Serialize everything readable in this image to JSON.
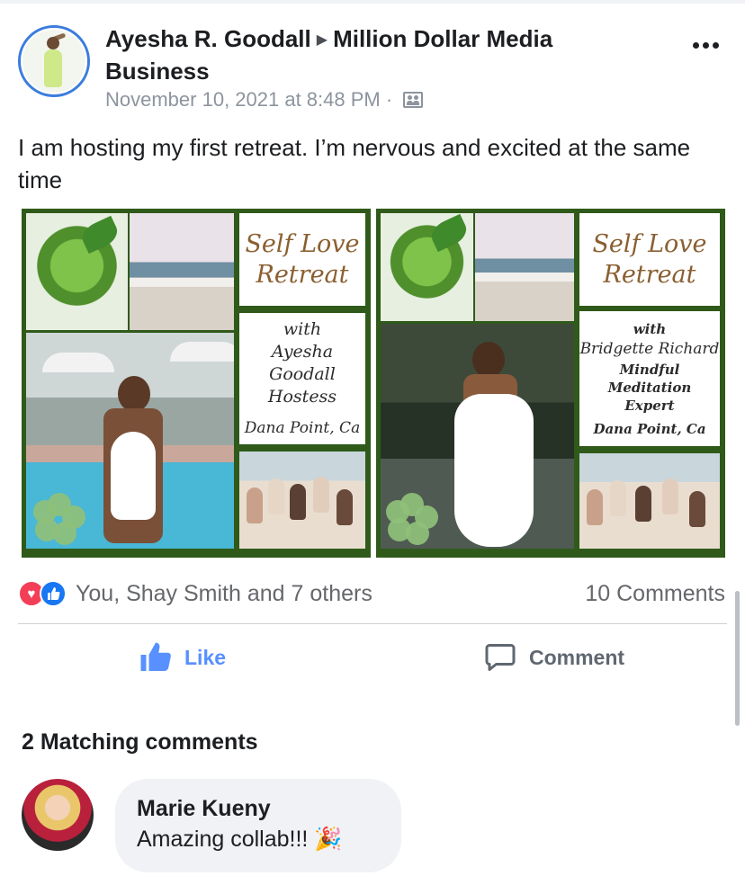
{
  "post": {
    "author_name": "Ayesha R. Goodall",
    "group_name": "Million Dollar Media Business",
    "timestamp": "November 10, 2021 at 8:48 PM",
    "separator": "·",
    "audience_icon": "friends-icon",
    "text": "I am hosting my first retreat. I’m nervous and excited at the same time"
  },
  "flyers": [
    {
      "title_line1": "Self Love",
      "title_line2": "Retreat",
      "with_label": "with",
      "host_name": "Ayesha Goodall",
      "role": "Hostess",
      "location": "Dana Point, Ca"
    },
    {
      "title_line1": "Self Love",
      "title_line2": "Retreat",
      "with_label": "with",
      "host_name": "Bridgette Richard",
      "role_line1": "Mindful Meditation",
      "role_line2": "Expert",
      "location": "Dana Point, Ca"
    }
  ],
  "reactions": {
    "icons": [
      "love-icon",
      "like-icon"
    ],
    "summary": "You, Shay Smith and 7 others",
    "comments_count": "10 Comments"
  },
  "actions": {
    "like_label": "Like",
    "comment_label": "Comment"
  },
  "comments_section": {
    "heading": "2 Matching comments",
    "comments": [
      {
        "author": "Marie Kueny",
        "text": "Amazing collab!!! 🎉"
      }
    ]
  },
  "colors": {
    "like_blue": "#5890ff",
    "love_red": "#f33e58",
    "frame_green": "#2f5a1a",
    "muted_text": "#65676b"
  }
}
